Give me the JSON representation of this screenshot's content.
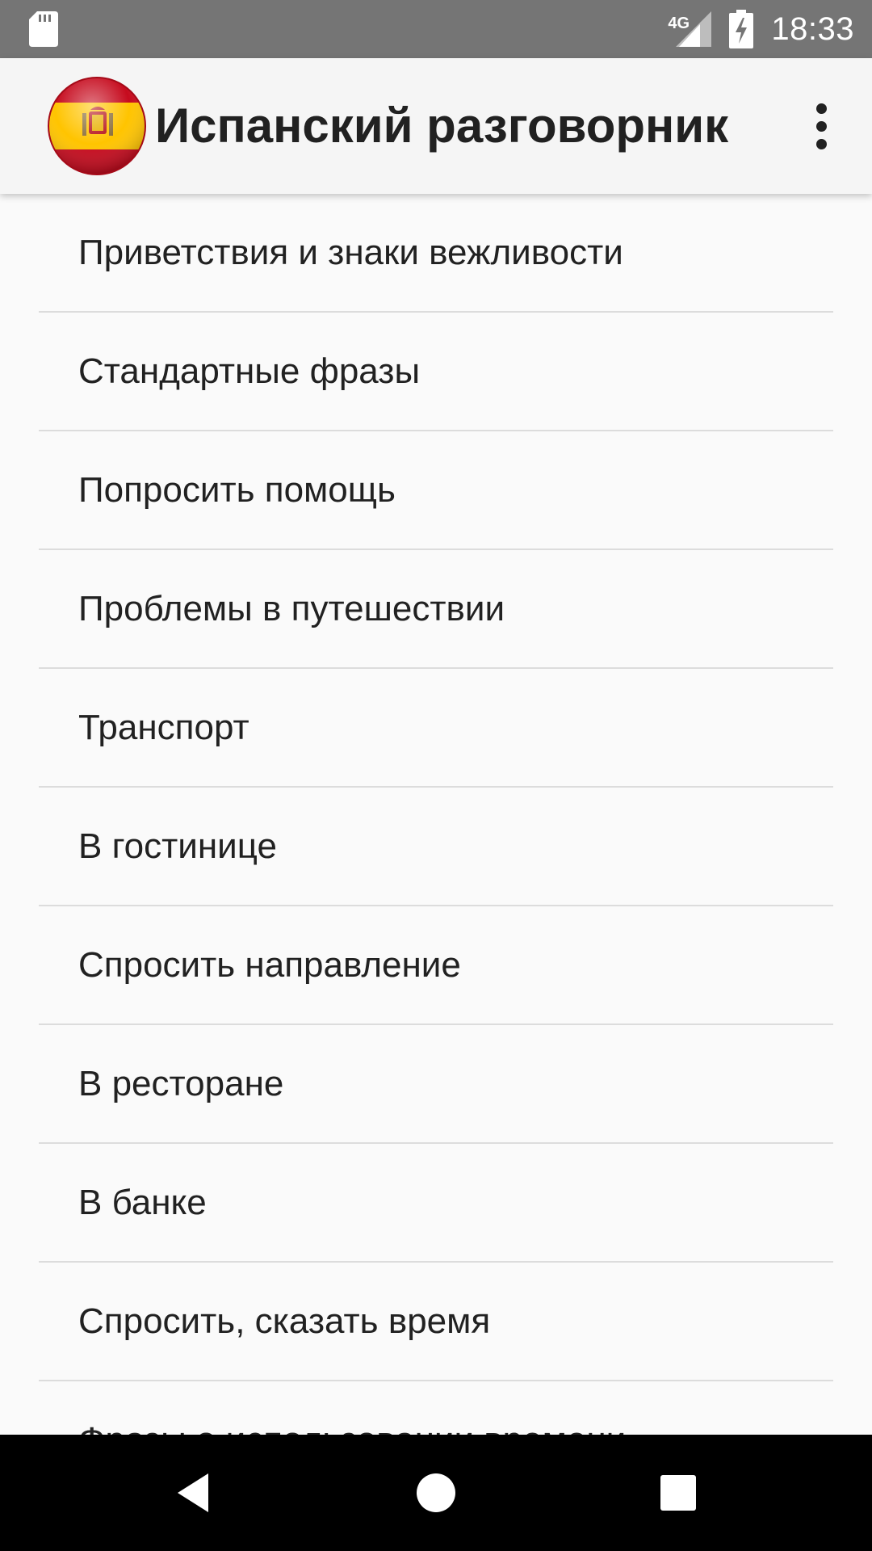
{
  "status_bar": {
    "network_type": "4G",
    "time": "18:33",
    "icons": [
      "sd-card-icon",
      "signal-icon",
      "battery-charging-icon"
    ]
  },
  "app_bar": {
    "title": "Испанский разговорник",
    "icon": "spain-flag-icon",
    "menu_icon": "overflow-menu-icon"
  },
  "categories": [
    "Приветствия и знаки вежливости",
    "Стандартные фразы",
    "Попросить помощь",
    "Проблемы в путешествии",
    "Транспорт",
    "В гостинице",
    "Спросить направление",
    "В ресторане",
    "В банке",
    "Спросить, сказать время",
    "Фразы о использовании времени"
  ],
  "nav_bar": {
    "icons": [
      "back-icon",
      "home-icon",
      "recents-icon"
    ]
  },
  "colors": {
    "status_bar": "#757575",
    "app_bar": "#f5f5f5",
    "background": "#fafafa",
    "flag_red": "#c60b1e",
    "flag_yellow": "#ffc400"
  }
}
